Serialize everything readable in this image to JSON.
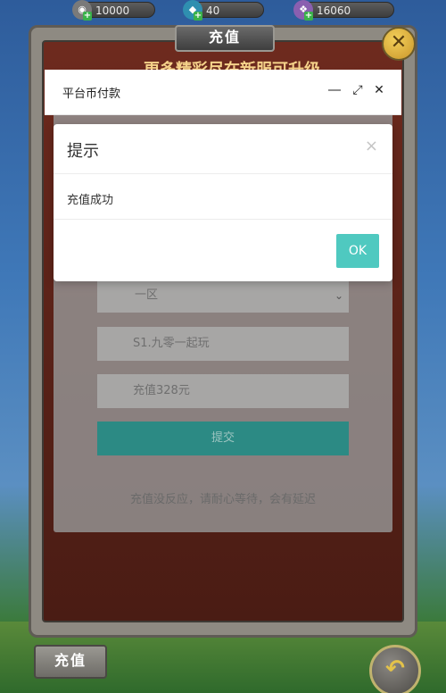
{
  "currencies": [
    {
      "icon": "coin-icon",
      "value": "10000"
    },
    {
      "icon": "diamond-icon",
      "value": "40"
    },
    {
      "icon": "gem-icon",
      "value": "16060"
    }
  ],
  "game": {
    "title": "充值",
    "banner": "更多精彩尽在新服可升级",
    "bottom_tab": "充值"
  },
  "payment": {
    "title": "平台币付款",
    "server_value": "一区",
    "role_value": "S1.九零一起玩",
    "amount_value": "充值328元",
    "submit_label": "提交",
    "hint": "充值没反应，请耐心等待，会有延迟"
  },
  "alert": {
    "title": "提示",
    "message": "充值成功",
    "ok_label": "OK",
    "close_glyph": "×"
  },
  "colors": {
    "accent": "#4fc9c0",
    "submit": "#2c8a84",
    "frame": "#8e8a82"
  }
}
